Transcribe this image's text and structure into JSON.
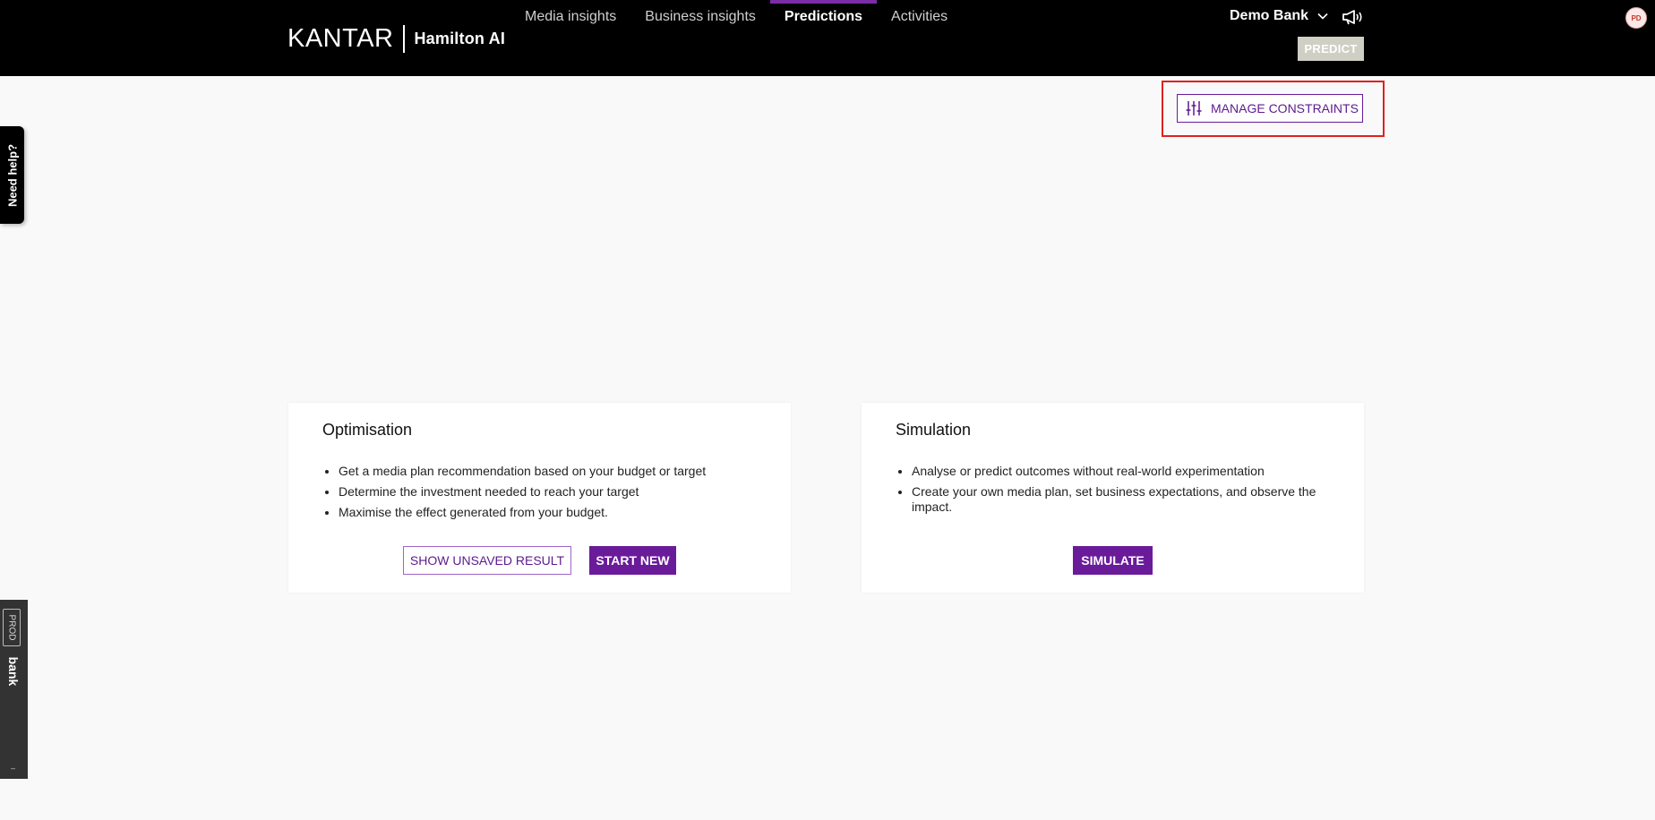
{
  "header": {
    "logo": "KANTAR",
    "product": "Hamilton AI",
    "nav": [
      {
        "label": "Media insights",
        "active": false
      },
      {
        "label": "Business insights",
        "active": false
      },
      {
        "label": "Predictions",
        "active": true
      },
      {
        "label": "Activities",
        "active": false
      }
    ],
    "account": "Demo Bank",
    "avatar_initials": "PD",
    "predict_label": "PREDICT"
  },
  "toolbar": {
    "manage_constraints_label": "MANAGE CONSTRAINTS"
  },
  "side": {
    "need_help": "Need help?",
    "env_badge": "PROD",
    "env_name": "bank",
    "env_mark": "–"
  },
  "cards": {
    "optimisation": {
      "title": "Optimisation",
      "bullets": [
        "Get a media plan recommendation based on your budget or target",
        "Determine the investment needed to reach your target",
        "Maximise the effect generated from your budget."
      ],
      "secondary_label": "SHOW UNSAVED RESULT",
      "primary_label": "START NEW"
    },
    "simulation": {
      "title": "Simulation",
      "bullets": [
        "Analyse or predict outcomes without real-world experimentation",
        "Create your own media plan, set business expectations, and observe the impact."
      ],
      "primary_label": "SIMULATE"
    }
  },
  "colors": {
    "accent": "#6a1b9a",
    "header_bg": "#000000",
    "page_bg": "#f9f9f9",
    "highlight": "#e02020"
  },
  "icons": {
    "account_dropdown": "chevron-down-icon",
    "announcements": "megaphone-icon",
    "constraints": "sliders-icon"
  }
}
